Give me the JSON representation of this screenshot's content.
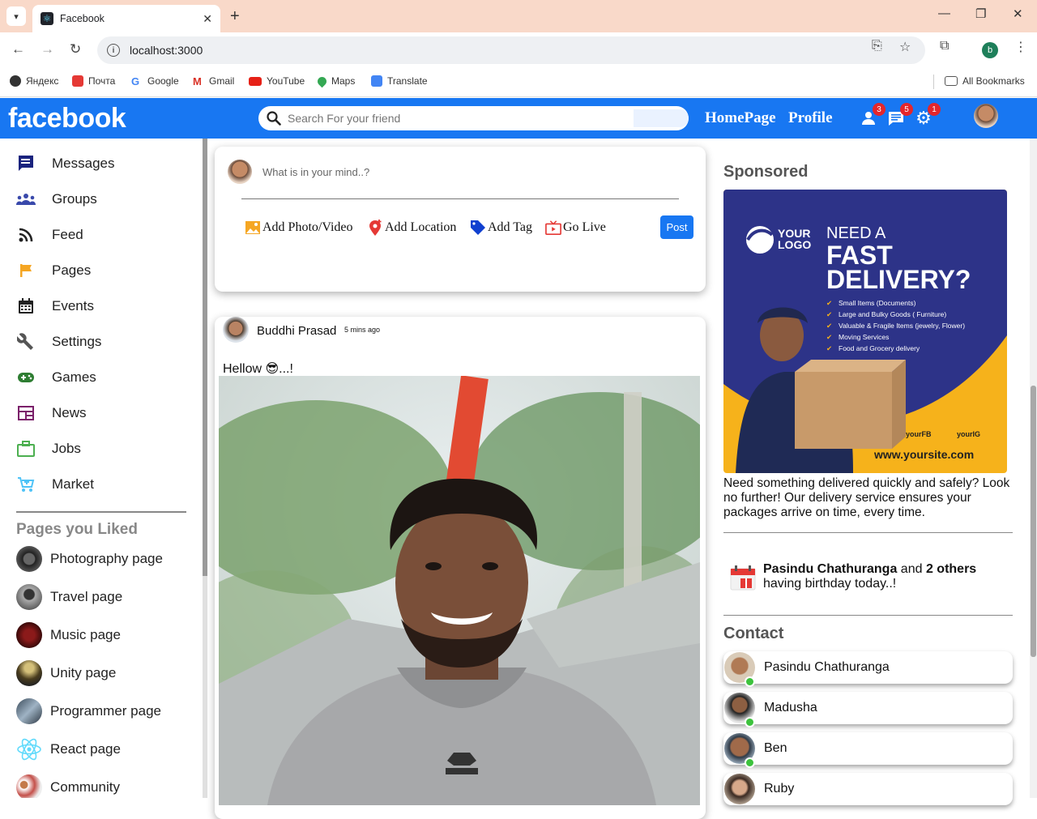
{
  "browser": {
    "tab_title": "Facebook",
    "url": "localhost:3000",
    "profile_initial": "b",
    "bookmarks": [
      "Яндекс",
      "Почта",
      "Google",
      "Gmail",
      "YouTube",
      "Maps",
      "Translate"
    ],
    "all_bookmarks": "All Bookmarks"
  },
  "header": {
    "logo": "facebook",
    "search_placeholder": "Search For your friend",
    "links": [
      "HomePage",
      "Profile"
    ],
    "badges": {
      "friends": "3",
      "messages": "5",
      "settings": "1"
    },
    "brand_color": "#1877f2"
  },
  "sidebar": {
    "items": [
      {
        "label": "Messages",
        "icon": "message-icon",
        "color": "#1a237e"
      },
      {
        "label": "Groups",
        "icon": "groups-icon",
        "color": "#3949ab"
      },
      {
        "label": "Feed",
        "icon": "rss-feed-icon",
        "color": "#222"
      },
      {
        "label": "Pages",
        "icon": "flag-icon",
        "color": "#f5a623"
      },
      {
        "label": "Events",
        "icon": "calendar-icon",
        "color": "#222"
      },
      {
        "label": "Settings",
        "icon": "wrench-icon",
        "color": "#555"
      },
      {
        "label": "Games",
        "icon": "gamepad-icon",
        "color": "#2e7d32"
      },
      {
        "label": "News",
        "icon": "newspaper-icon",
        "color": "#7b1f6a"
      },
      {
        "label": "Jobs",
        "icon": "briefcase-icon",
        "color": "#4caf50"
      },
      {
        "label": "Market",
        "icon": "cart-icon",
        "color": "#4fc3f7"
      }
    ],
    "pages_heading": "Pages you Liked",
    "pages": [
      {
        "label": "Photography page"
      },
      {
        "label": "Travel page"
      },
      {
        "label": "Music page"
      },
      {
        "label": "Unity page"
      },
      {
        "label": "Programmer page"
      },
      {
        "label": "React page"
      },
      {
        "label": "Community"
      }
    ]
  },
  "share": {
    "prompt": "What is in your mind..?",
    "options": [
      "Add Photo/Video",
      "Add Location",
      "Add Tag",
      "Go Live"
    ],
    "post_label": "Post"
  },
  "post": {
    "author": "Buddhi Prasad",
    "time": "5 mins ago",
    "caption": "Hellow 😎...!"
  },
  "right": {
    "sponsored_heading": "Sponsored",
    "ad": {
      "logo_line1": "YOUR",
      "logo_line2": "LOGO",
      "headline1": "NEED A",
      "headline2": "FAST",
      "headline3": "DELIVERY?",
      "bullets": [
        "Small Items (Documents)",
        "Large and Bulky Goods ( Furniture)",
        "Valuable & Fragile Items (jewelry, Flower)",
        "Moving Services",
        "Food and Grocery delivery"
      ],
      "social1": "yourFB",
      "social2": "yourIG",
      "website": "www.yoursite.com"
    },
    "ad_description": "Need something delivered quickly and safely? Look no further! Our delivery service ensures your packages arrive on time, every time.",
    "birthday": {
      "name": "Pasindu Chathuranga",
      "and": " and ",
      "others": "2 others",
      "rest": "having birthday today..!"
    },
    "contact_heading": "Contact",
    "contacts": [
      {
        "name": "Pasindu Chathuranga",
        "online": true
      },
      {
        "name": "Madusha",
        "online": true
      },
      {
        "name": "Ben",
        "online": true
      },
      {
        "name": "Ruby",
        "online": false
      }
    ]
  }
}
